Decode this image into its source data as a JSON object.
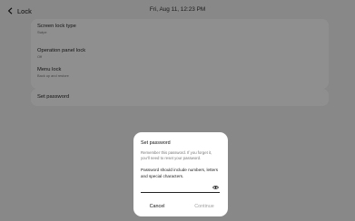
{
  "header": {
    "back_label": "Lock",
    "datetime": "Fri, Aug 11, 12:23 PM"
  },
  "settings": {
    "items": [
      {
        "title": "Screen lock type",
        "subtitle": "Swipe"
      },
      {
        "title": "Operation panel lock",
        "subtitle": "Off"
      },
      {
        "title": "Menu lock",
        "subtitle": "Back up and restore"
      },
      {
        "title": "Set password",
        "subtitle": ""
      }
    ]
  },
  "dialog": {
    "title": "Set password",
    "body": "Remember this password. If you forget it, you'll need to reset your password.",
    "requirement": "Password should include numbers, letters and special characters.",
    "password_value": "",
    "cancel_label": "Cancel",
    "continue_label": "Continue",
    "continue_enabled": false
  },
  "icons": {
    "back": "chevron-left-icon",
    "reveal_password": "eye-icon"
  }
}
